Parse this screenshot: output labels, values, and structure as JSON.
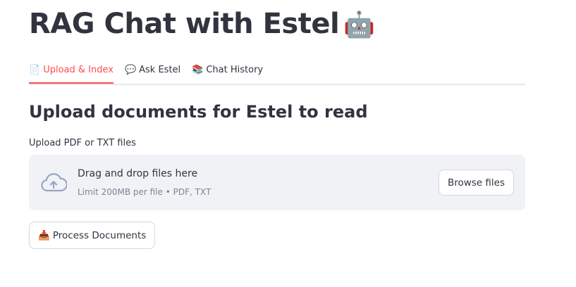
{
  "header": {
    "title": "RAG Chat with Estel",
    "title_emoji": "🤖",
    "title_emoji_name": "robot-icon"
  },
  "tabs": [
    {
      "icon": "📄",
      "icon_name": "page-icon",
      "label": "Upload & Index",
      "active": true
    },
    {
      "icon": "💬",
      "icon_name": "speech-bubble-icon",
      "label": "Ask Estel",
      "active": false
    },
    {
      "icon": "📚",
      "icon_name": "books-icon",
      "label": "Chat History",
      "active": false
    }
  ],
  "upload": {
    "heading": "Upload documents for Estel to read",
    "label": "Upload PDF or TXT files",
    "dropzone": {
      "primary": "Drag and drop files here",
      "secondary": "Limit 200MB per file • PDF, TXT",
      "icon_name": "cloud-upload-icon"
    },
    "browse_label": "Browse files"
  },
  "process": {
    "icon": "📥",
    "icon_name": "inbox-tray-icon",
    "label": "Process Documents"
  },
  "colors": {
    "accent": "#ff4b4b",
    "text": "#31333f",
    "muted": "#808495",
    "dropzone_bg": "#f0f2f6"
  }
}
